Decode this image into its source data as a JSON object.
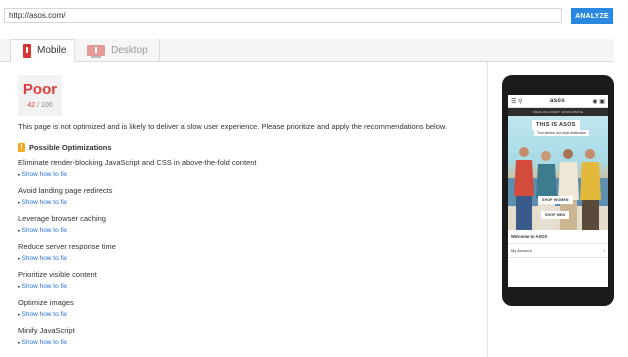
{
  "url_bar": {
    "value": "http://asos.com/",
    "button": "ANALYZE"
  },
  "tabs": [
    {
      "label": "Mobile",
      "active": true,
      "icon": "phone-icon"
    },
    {
      "label": "Desktop",
      "active": false,
      "icon": "desktop-icon"
    }
  ],
  "score": {
    "label": "Poor",
    "value": "42",
    "max": "/ 100",
    "color": "#dd3d3d"
  },
  "summary": "This page is not optimized and is likely to deliver a slow user experience. Please prioritize and apply the recommendations below.",
  "section": {
    "icon": "!",
    "title": "Possible Optimizations"
  },
  "rules": [
    {
      "title": "Eliminate render-blocking JavaScript and CSS in above-the-fold content",
      "link": "Show how to fix"
    },
    {
      "title": "Avoid landing page redirects",
      "link": "Show how to fix"
    },
    {
      "title": "Leverage browser caching",
      "link": "Show how to fix"
    },
    {
      "title": "Reduce server response time",
      "link": "Show how to fix"
    },
    {
      "title": "Prioritize visible content",
      "link": "Show how to fix"
    },
    {
      "title": "Optimize images",
      "link": "Show how to fix"
    },
    {
      "title": "Minify JavaScript",
      "link": "Show how to fix"
    }
  ],
  "preview": {
    "logo": "asos",
    "banner": "FREE DELIVERY WORLDWIDE",
    "hero_title": "THIS IS ASOS",
    "hero_sub": "Your fashion and style destination",
    "buttons": [
      "SHOP WOMEN",
      "SHOP MEN"
    ],
    "welcome": "Welcome to ASOS",
    "account": "My Account",
    "account_chevron": "›"
  },
  "accent_color": "#2a88e0"
}
